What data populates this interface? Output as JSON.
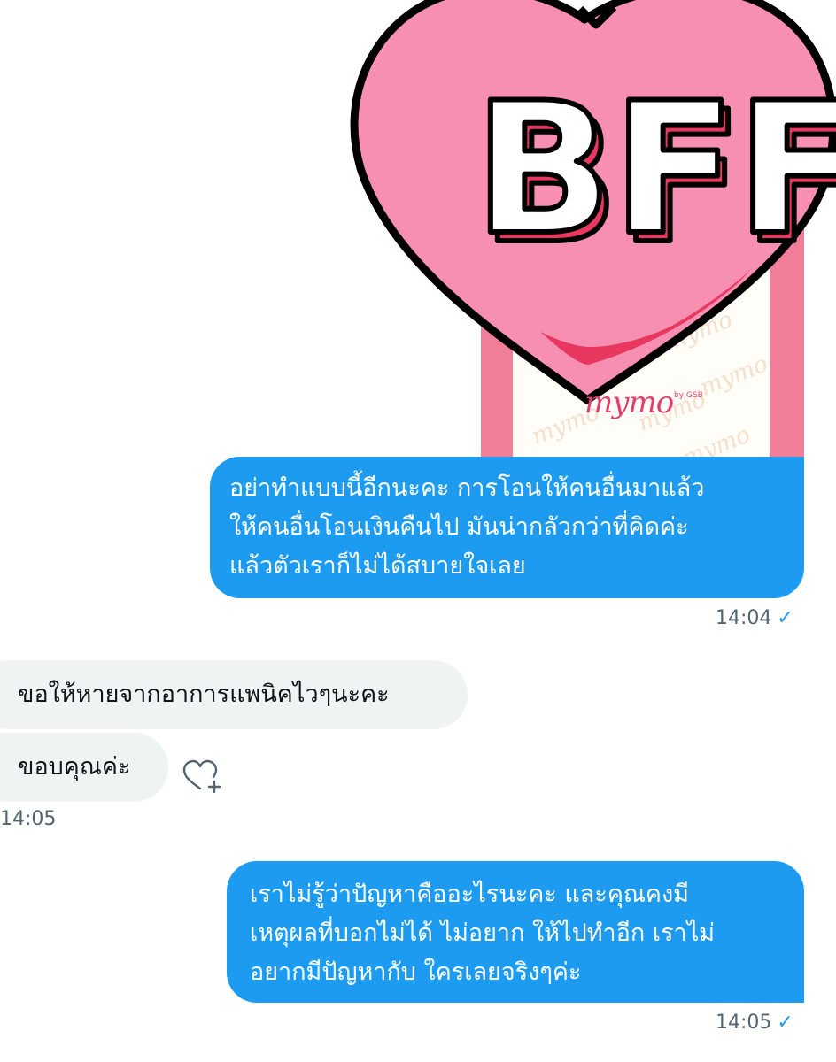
{
  "media": {
    "sticker_text": "BFF",
    "logo_text": "mymo",
    "logo_by": "by GSB",
    "pattern_text": "mymo",
    "colors": {
      "heart_fill": "#f78fb3",
      "heart_outline": "#000000",
      "heart_inner_line": "#e8385f",
      "letter_fill": "#ffffff",
      "letter_shadow": "#e8385f",
      "phone_frame": "#f07e98"
    }
  },
  "messages": [
    {
      "direction": "sent",
      "lines": [
        "อย่าทำแบบนี้อีกนะคะ การโอนให้คนอื่นมาแล้ว",
        "ให้คนอื่นโอนเงินคืนไป มันน่ากลัวกว่าที่คิดค่ะ",
        "แล้วตัวเราก็ไม่ได้สบายใจเลย"
      ],
      "time": "14:04",
      "status_icon": "check-icon"
    },
    {
      "direction": "received",
      "lines": [
        "ขอให้หายจากอาการแพนิคไวๆนะคะ"
      ]
    },
    {
      "direction": "received",
      "lines": [
        "ขอบคุณค่ะ"
      ],
      "time": "14:05",
      "reaction_icon": "heart-plus-icon"
    },
    {
      "direction": "sent",
      "lines": [
        "เราไม่รู้ว่าปัญหาคืออะไรนะคะ และคุณคงมี",
        "เหตุผลที่บอกไม่ได้ ไม่อยาก ให้ไปทำอีก เราไม่",
        "อยากมีปัญหากับ ใครเลยจริงๆค่ะ"
      ],
      "time": "14:05",
      "status_icon": "check-icon"
    }
  ],
  "colors": {
    "sent_bubble": "#1d9bf0",
    "received_bubble": "#eff3f4",
    "timestamp": "#536471",
    "check": "#1d9bf0"
  }
}
